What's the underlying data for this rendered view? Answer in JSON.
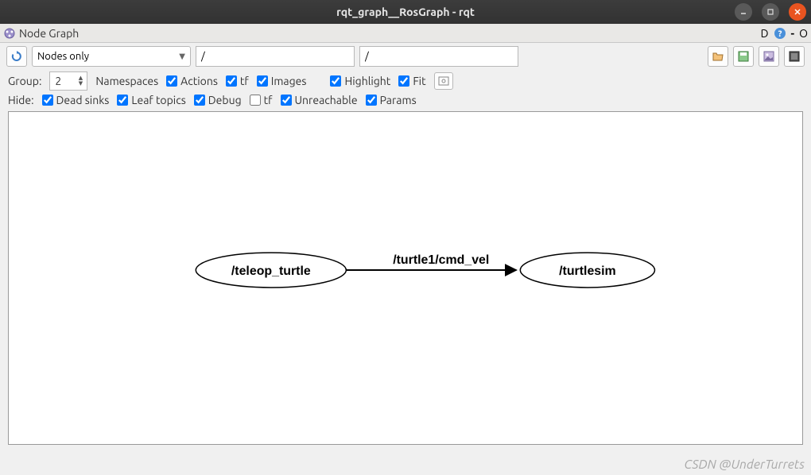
{
  "window": {
    "title": "rqt_graph__RosGraph - rqt"
  },
  "panel": {
    "title": "Node Graph",
    "d_label": "D",
    "dash": "-",
    "o_label": "O"
  },
  "toolbar": {
    "mode_selected": "Nodes only",
    "filter1": "/",
    "filter2": "/"
  },
  "group_row": {
    "label": "Group:",
    "value": "2",
    "namespaces": "Namespaces",
    "actions": "Actions",
    "tf": "tf",
    "images": "Images",
    "highlight": "Highlight",
    "fit": "Fit",
    "actions_checked": true,
    "tf_checked": true,
    "images_checked": true,
    "highlight_checked": true,
    "fit_checked": true
  },
  "hide_row": {
    "label": "Hide:",
    "dead_sinks": "Dead sinks",
    "leaf_topics": "Leaf topics",
    "debug": "Debug",
    "tf": "tf",
    "unreachable": "Unreachable",
    "params": "Params",
    "dead_sinks_checked": true,
    "leaf_topics_checked": true,
    "debug_checked": true,
    "tf_checked": false,
    "unreachable_checked": true,
    "params_checked": true
  },
  "graph": {
    "node1": "/teleop_turtle",
    "node2": "/turtlesim",
    "edge": "/turtle1/cmd_vel"
  },
  "watermark": "CSDN @UnderTurrets"
}
